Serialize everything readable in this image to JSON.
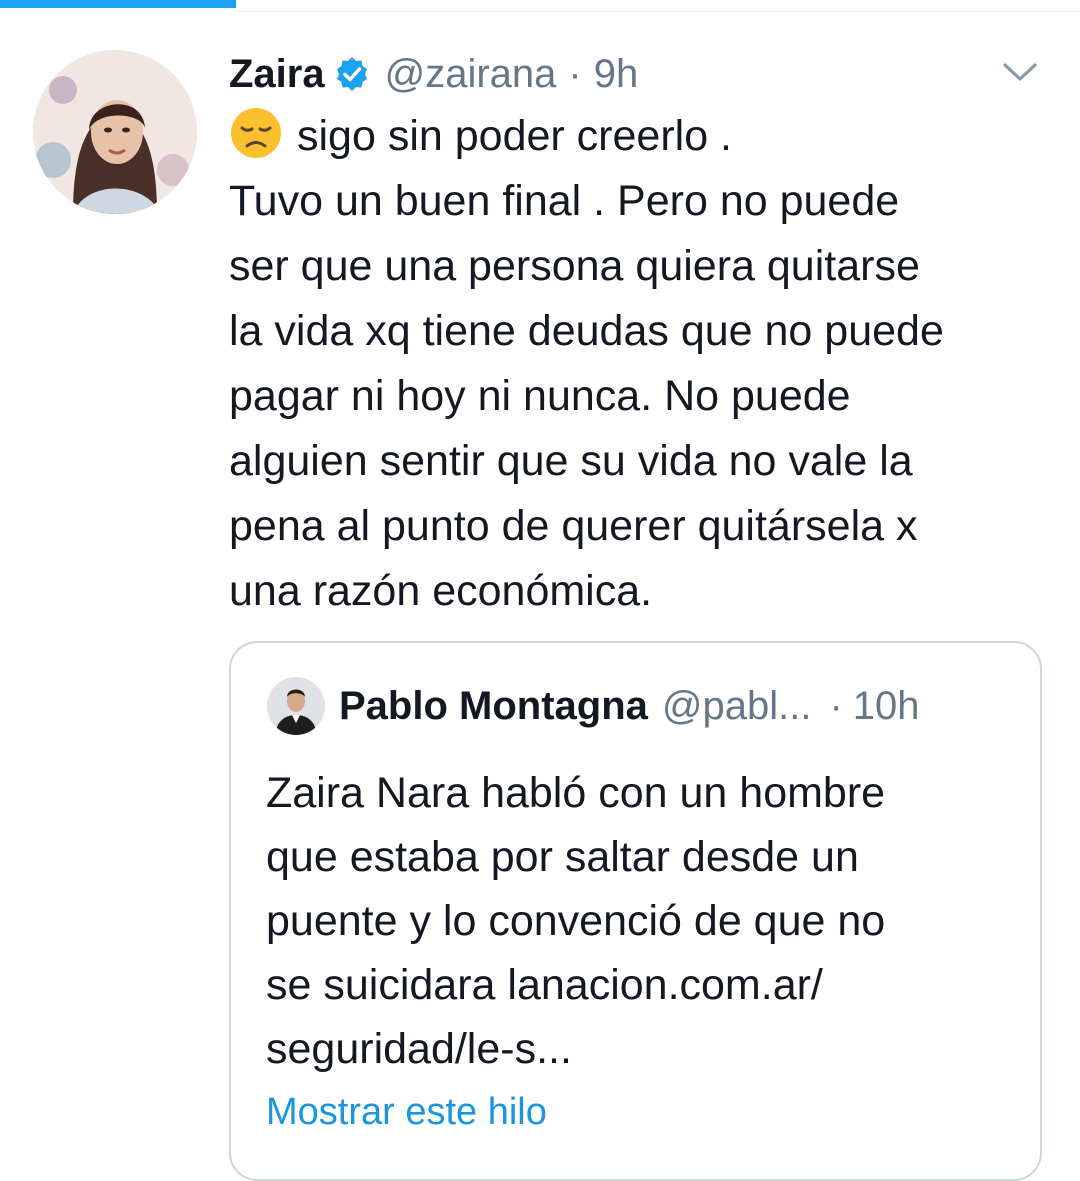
{
  "tweet": {
    "display_name": "Zaira",
    "handle": "@zairana",
    "separator": "·",
    "time": "9h",
    "verified_icon": "verified-badge-icon",
    "menu_icon": "chevron-down-icon",
    "emoji_icon": "disappointed-face-icon",
    "text_first_line": "sigo sin poder creerlo .",
    "text_body": "Tuvo un buen final . Pero no puede\nser que una persona quiera quitarse\nla vida xq tiene deudas que no puede\npagar ni hoy ni nunca. No puede\nalguien sentir que su vida no vale la\npena al punto de querer quitársela x\nuna razón económica."
  },
  "quoted_tweet": {
    "display_name": "Pablo Montagna",
    "handle": "@pabl...",
    "separator": "·",
    "time": "10h",
    "text": "Zaira Nara habló con un hombre\nque estaba por saltar desde un\npuente y lo convenció de que no\nse suicidara lanacion.com.ar/\nseguridad/le-s...",
    "show_thread_label": "Mostrar este hilo"
  },
  "colors": {
    "accent": "#1da1f2",
    "link": "#1b95e0",
    "secondary_text": "#657786",
    "primary_text": "#141823",
    "border": "#ccd6dd"
  }
}
